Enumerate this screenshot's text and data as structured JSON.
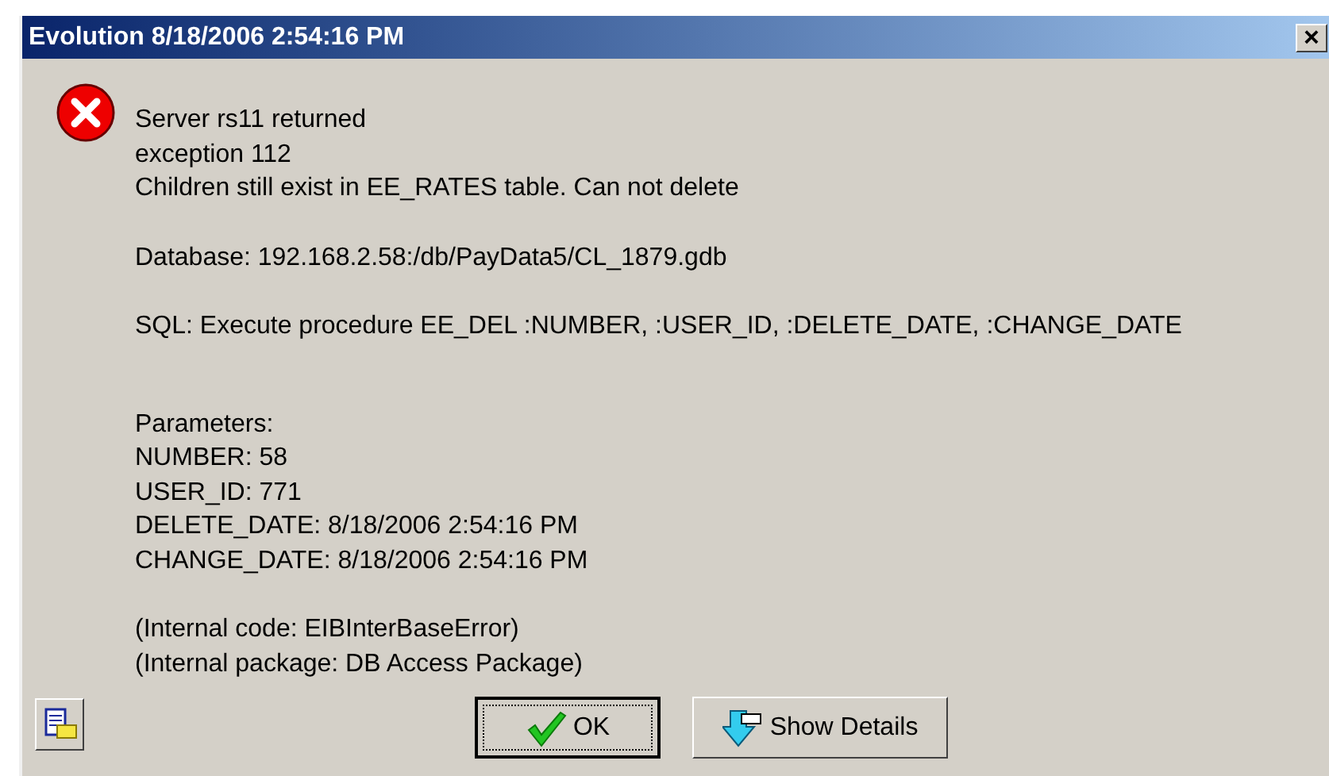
{
  "window": {
    "title": "Evolution 8/18/2006 2:54:16 PM",
    "close": "×"
  },
  "message_groups": [
    {
      "lines": [
        "Server rs11 returned",
        "exception 112",
        "Children still exist in EE_RATES table. Can not delete"
      ]
    },
    {
      "lines": [
        "Database: 192.168.2.58:/db/PayData5/CL_1879.gdb"
      ]
    },
    {
      "lines": [
        "SQL: Execute procedure EE_DEL :NUMBER, :USER_ID, :DELETE_DATE, :CHANGE_DATE"
      ]
    },
    {
      "lines": [
        "Parameters:",
        "NUMBER: 58",
        "USER_ID: 771",
        "DELETE_DATE: 8/18/2006 2:54:16 PM",
        "CHANGE_DATE: 8/18/2006 2:54:16 PM"
      ]
    },
    {
      "lines": [
        "(Internal code: EIBInterBaseError)",
        "(Internal package: DB Access Package)"
      ]
    }
  ],
  "buttons": [
    {
      "kind": "ok",
      "label": "OK"
    },
    {
      "kind": "details",
      "label": "Show Details"
    }
  ]
}
